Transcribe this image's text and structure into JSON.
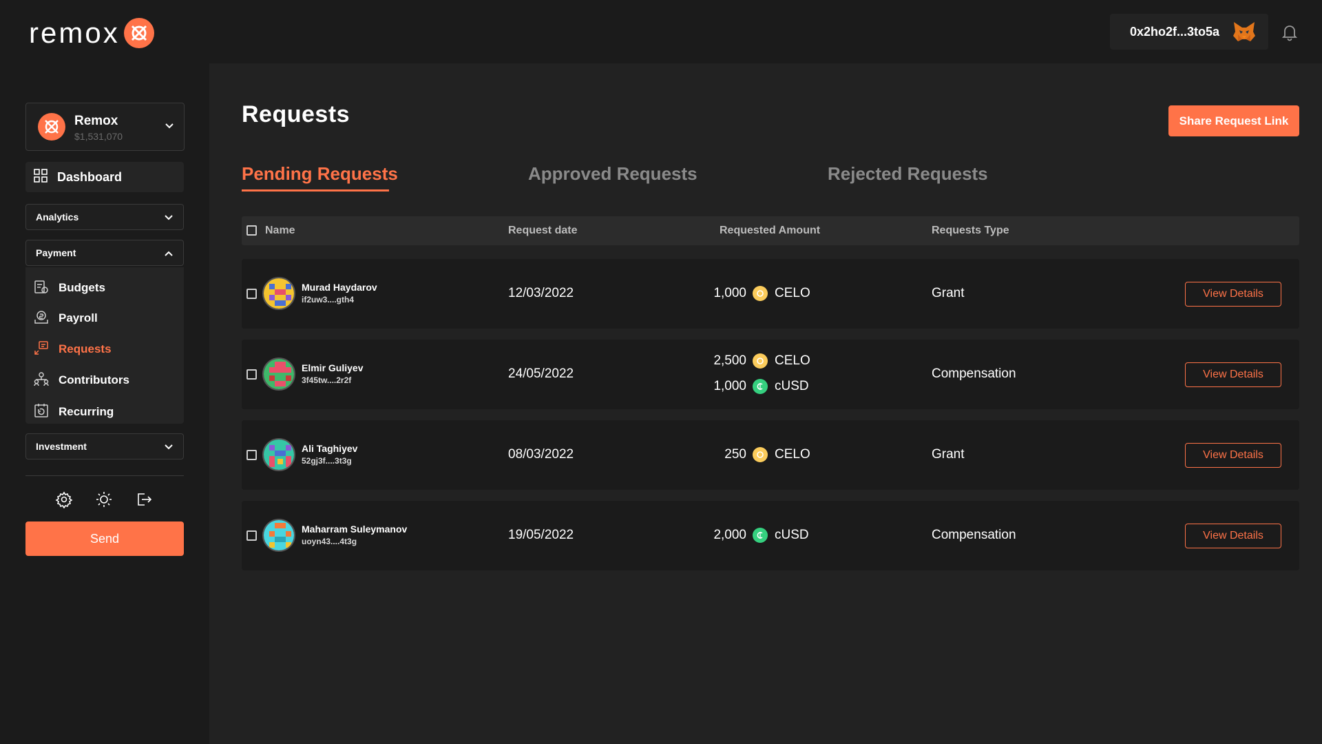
{
  "brand": {
    "logo_text": "remox",
    "accent": "#ff7348"
  },
  "topbar": {
    "wallet_address": "0x2ho2f...3to5a"
  },
  "sidebar": {
    "org": {
      "name": "Remox",
      "balance": "$1,531,070"
    },
    "dashboard_label": "Dashboard",
    "analytics_label": "Analytics",
    "payment_label": "Payment",
    "payment_items": [
      {
        "label": "Budgets",
        "icon": "budgets-icon"
      },
      {
        "label": "Payroll",
        "icon": "payroll-icon"
      },
      {
        "label": "Requests",
        "icon": "requests-icon",
        "active": true
      },
      {
        "label": "Contributors",
        "icon": "contributors-icon"
      },
      {
        "label": "Recurring",
        "icon": "recurring-icon"
      }
    ],
    "investment_label": "Investment",
    "send_label": "Send"
  },
  "main": {
    "title": "Requests",
    "share_label": "Share Request Link",
    "tabs": [
      {
        "label": "Pending Requests",
        "active": true
      },
      {
        "label": "Approved Requests"
      },
      {
        "label": "Rejected Requests"
      }
    ],
    "table": {
      "headers": {
        "name": "Name",
        "date": "Request date",
        "amount": "Requested Amount",
        "type": "Requests Type"
      },
      "view_label": "View Details",
      "rows": [
        {
          "name": "Murad Haydarov",
          "address": "if2uw3....gth4",
          "date": "12/03/2022",
          "amounts": [
            {
              "value": "1,000",
              "currency": "CELO"
            }
          ],
          "type": "Grant"
        },
        {
          "name": "Elmir Guliyev",
          "address": "3f45tw....2r2f",
          "date": "24/05/2022",
          "amounts": [
            {
              "value": "2,500",
              "currency": "CELO"
            },
            {
              "value": "1,000",
              "currency": "cUSD"
            }
          ],
          "type": "Compensation"
        },
        {
          "name": "Ali Taghiyev",
          "address": "52gj3f....3t3g",
          "date": "08/03/2022",
          "amounts": [
            {
              "value": "250",
              "currency": "CELO"
            }
          ],
          "type": "Grant"
        },
        {
          "name": "Maharram Suleymanov",
          "address": "uoyn43....4t3g",
          "date": "19/05/2022",
          "amounts": [
            {
              "value": "2,000",
              "currency": "cUSD"
            }
          ],
          "type": "Compensation"
        }
      ]
    }
  }
}
